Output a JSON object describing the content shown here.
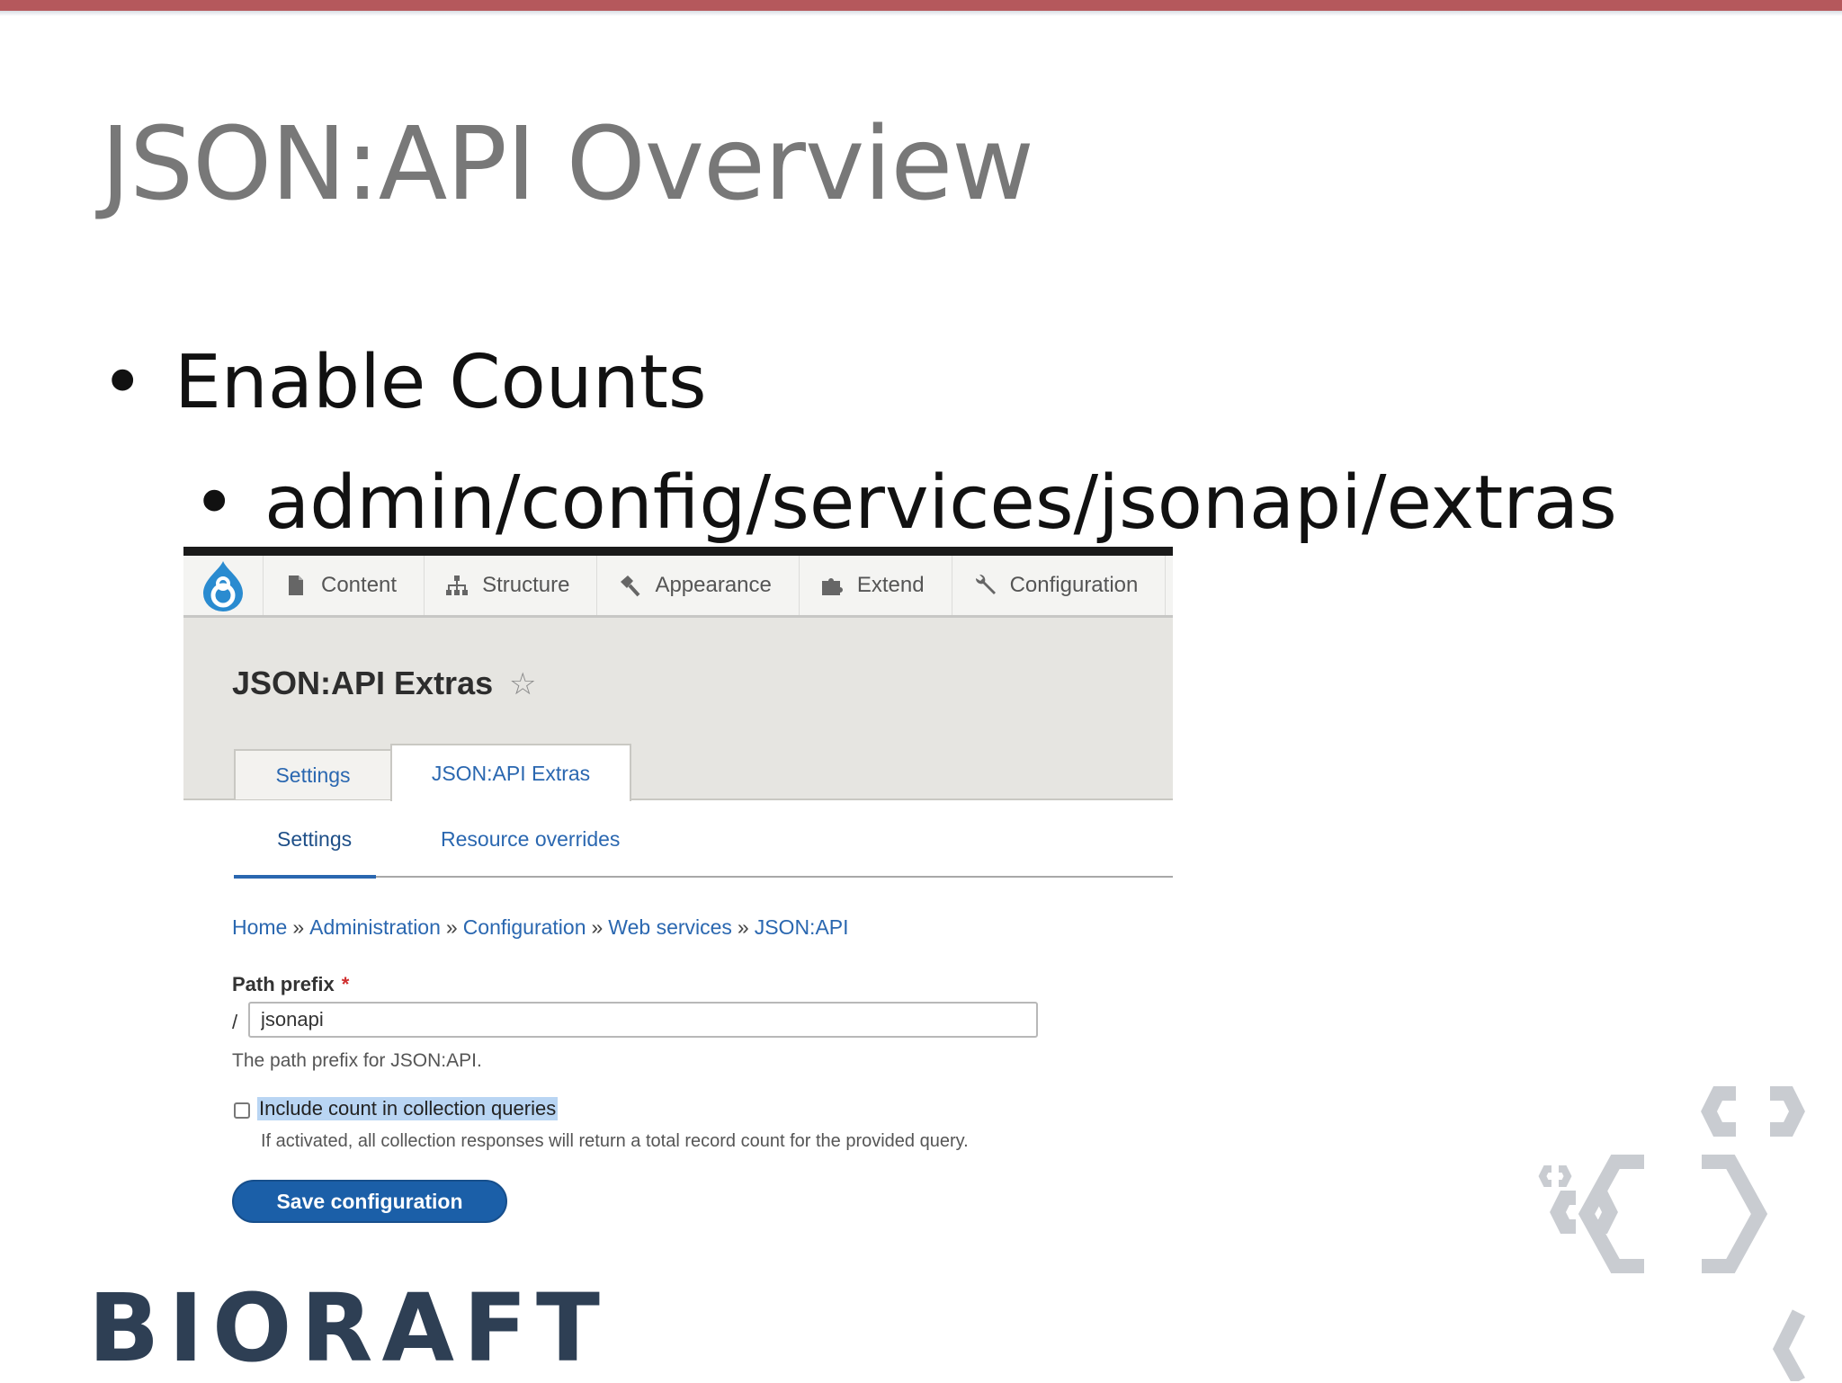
{
  "slide": {
    "title": "JSON:API Overview",
    "bullet_1": "Enable Counts",
    "bullet_2": "admin/config/services/jsonapi/extras",
    "bullet_glyph": "•",
    "brand": "BIORAFT"
  },
  "drupal": {
    "toolbar": {
      "items": [
        {
          "label": "Content",
          "icon": "file-icon"
        },
        {
          "label": "Structure",
          "icon": "sitemap-icon"
        },
        {
          "label": "Appearance",
          "icon": "paintbrush-icon"
        },
        {
          "label": "Extend",
          "icon": "puzzle-icon"
        },
        {
          "label": "Configuration",
          "icon": "wrench-icon"
        }
      ]
    },
    "page_title": "JSON:API Extras",
    "star_glyph": "☆",
    "tabs": [
      {
        "label": "Settings",
        "active": false
      },
      {
        "label": "JSON:API Extras",
        "active": true
      }
    ],
    "subtabs": [
      {
        "label": "Settings",
        "active": true
      },
      {
        "label": "Resource overrides",
        "active": false
      }
    ],
    "breadcrumb": {
      "items": [
        "Home",
        "Administration",
        "Configuration",
        "Web services",
        "JSON:API"
      ],
      "separator": "»"
    },
    "path_prefix": {
      "label": "Path prefix",
      "required_marker": "*",
      "slash": "/",
      "value": "jsonapi",
      "description": "The path prefix for JSON:API."
    },
    "include_count": {
      "label": "Include count in collection queries",
      "checked": false,
      "description": "If activated, all collection responses will return a total record count for the provided query."
    },
    "save_button": "Save configuration"
  },
  "colors": {
    "top_bar": "#b5585c",
    "title_gray": "#787878",
    "link_blue": "#2a67b0",
    "button_blue": "#1b5fa8",
    "brand_navy": "#2e3f54"
  }
}
